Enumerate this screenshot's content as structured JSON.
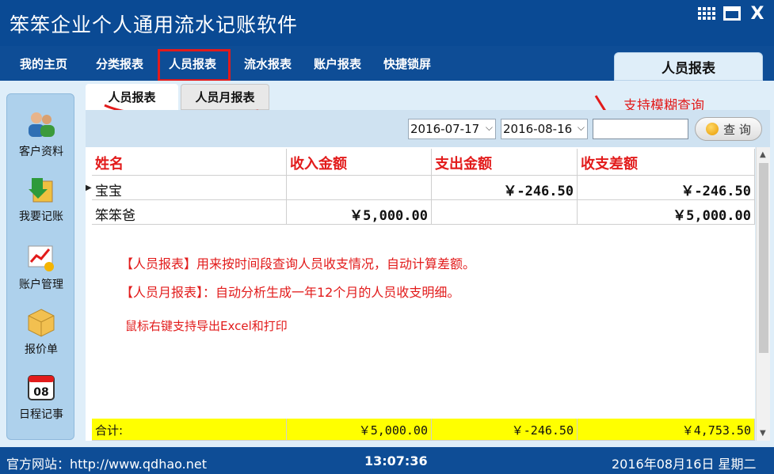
{
  "app": {
    "title": "笨笨企业个人通用流水记账软件"
  },
  "menu": {
    "items": [
      "我的主页",
      "分类报表",
      "人员报表",
      "流水报表",
      "账户报表",
      "快捷锁屏"
    ],
    "active_tab": "人员报表"
  },
  "sidebar": {
    "items": [
      "客户资料",
      "我要记账",
      "账户管理",
      "报价单",
      "日程记事"
    ],
    "calendar_num": "08"
  },
  "subtabs": [
    "人员报表",
    "人员月报表"
  ],
  "filter": {
    "date_from": "2016-07-17",
    "date_to": "2016-08-16",
    "search_value": "",
    "query_label": "查 询",
    "hint": "支持模糊查询"
  },
  "table": {
    "columns": [
      "姓名",
      "收入金额",
      "支出金额",
      "收支差额"
    ],
    "rows": [
      [
        "宝宝",
        "",
        "￥-246.50",
        "￥-246.50"
      ],
      [
        "笨笨爸",
        "￥5,000.00",
        "",
        "￥5,000.00"
      ]
    ],
    "total": [
      "合计:",
      "￥5,000.00",
      "￥-246.50",
      "￥4,753.50"
    ]
  },
  "notes": [
    "【人员报表】用来按时间段查询人员收支情况，自动计算差额。",
    "【人员月报表】：自动分析生成一年12个月的人员收支明细。",
    "鼠标右键支持导出Excel和打印"
  ],
  "status": {
    "website": "官方网站：http://www.qdhao.net",
    "time": "13:07:36",
    "date": "2016年08月16日  星期二"
  },
  "colors": {
    "accent_red": "#e21b1b",
    "title_blue": "#0a4a94",
    "total_yellow": "#ffff00"
  }
}
